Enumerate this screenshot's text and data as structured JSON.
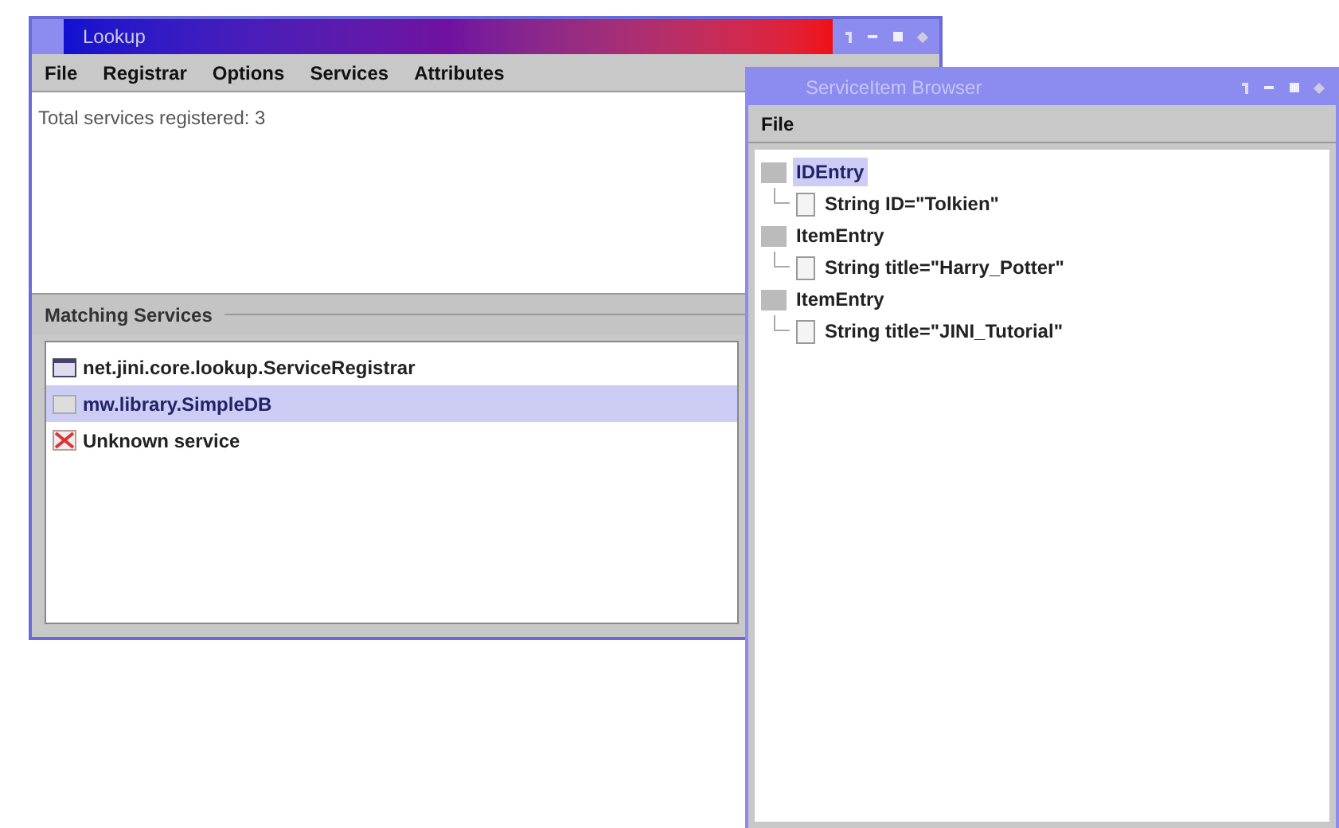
{
  "lookup_window": {
    "title": "Lookup",
    "menu": [
      "File",
      "Registrar",
      "Options",
      "Services",
      "Attributes"
    ],
    "status_text": "Total services registered: 3",
    "matching_services": {
      "heading": "Matching Services",
      "items": [
        {
          "label": "net.jini.core.lookup.ServiceRegistrar",
          "kind": "registrar",
          "selected": false
        },
        {
          "label": "mw.library.SimpleDB",
          "kind": "service",
          "selected": true
        },
        {
          "label": "Unknown service",
          "kind": "unknown",
          "selected": false
        }
      ]
    }
  },
  "browser_window": {
    "title": "ServiceItem Browser",
    "menu": [
      "File"
    ],
    "tree": [
      {
        "label": "IDEntry",
        "selected": true,
        "children": [
          {
            "label": "String ID=\"Tolkien\"",
            "selected": false
          }
        ]
      },
      {
        "label": "ItemEntry",
        "selected": false,
        "children": [
          {
            "label": "String title=\"Harry_Potter\"",
            "selected": false
          }
        ]
      },
      {
        "label": "ItemEntry",
        "selected": false,
        "children": [
          {
            "label": "String title=\"JINI_Tutorial\"",
            "selected": false
          }
        ]
      }
    ]
  }
}
